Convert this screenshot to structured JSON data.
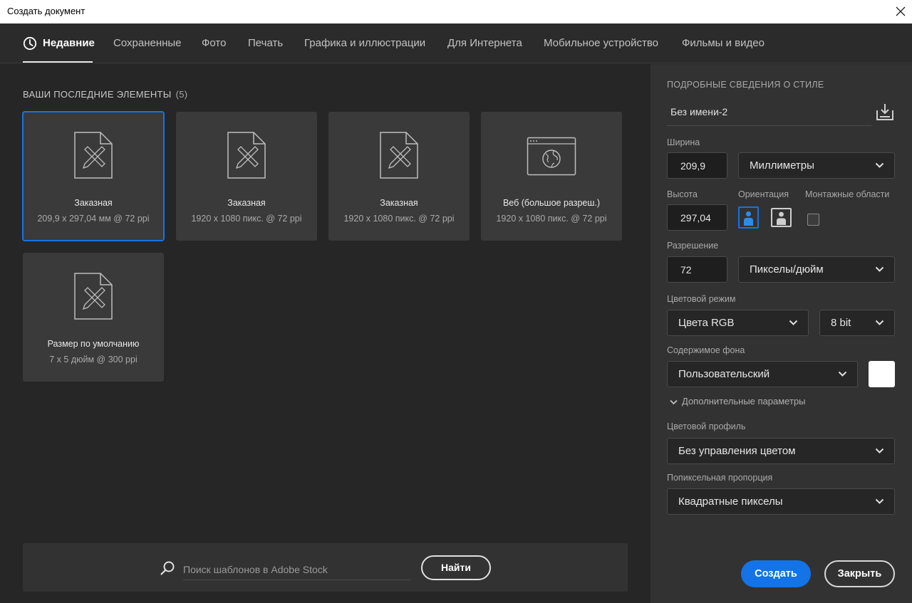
{
  "window": {
    "title": "Создать документ"
  },
  "tabs": [
    {
      "label": "Недавние",
      "active": true
    },
    {
      "label": "Сохраненные"
    },
    {
      "label": "Фото"
    },
    {
      "label": "Печать"
    },
    {
      "label": "Графика и иллюстрации"
    },
    {
      "label": "Для Интернета"
    },
    {
      "label": "Мобильное устройство"
    },
    {
      "label": "Фильмы и видео"
    }
  ],
  "recent": {
    "title": "ВАШИ ПОСЛЕДНИЕ ЭЛЕМЕНТЫ",
    "count": "(5)",
    "items": [
      {
        "name": "Заказная",
        "dims": "209,9 x 297,04 мм @ 72 ppi",
        "icon": "document-pen-ruler-icon",
        "selected": true
      },
      {
        "name": "Заказная",
        "dims": "1920 x 1080 пикс. @ 72 ppi",
        "icon": "document-pen-ruler-icon"
      },
      {
        "name": "Заказная",
        "dims": "1920 x 1080 пикс. @ 72 ppi",
        "icon": "document-pen-ruler-icon"
      },
      {
        "name": "Веб (большое разреш.)",
        "dims": "1920 x 1080 пикс. @ 72 ppi",
        "icon": "web-globe-icon"
      },
      {
        "name": "Размер по умолчанию",
        "dims": "7 x 5 дюйм @ 300 ppi",
        "icon": "document-pen-ruler-icon"
      }
    ]
  },
  "search": {
    "placeholder": "Поиск шаблонов в Adobe Stock",
    "button": "Найти"
  },
  "preset": {
    "heading": "ПОДРОБНЫЕ СВЕДЕНИЯ О СТИЛЕ",
    "name": "Без имени-2",
    "width_label": "Ширина",
    "width_value": "209,9",
    "width_unit": "Миллиметры",
    "height_label": "Высота",
    "height_value": "297,04",
    "orientation_label": "Ориентация",
    "orientation": "portrait",
    "artboards_label": "Монтажные области",
    "artboards_checked": false,
    "resolution_label": "Разрешение",
    "resolution_value": "72",
    "resolution_unit": "Пикселы/дюйм",
    "color_mode_label": "Цветовой режим",
    "color_mode": "Цвета RGB",
    "bit_depth": "8 bit",
    "background_label": "Содержимое фона",
    "background": "Пользовательский",
    "background_color": "#ffffff",
    "advanced_label": "Дополнительные параметры",
    "color_profile_label": "Цветовой профиль",
    "color_profile": "Без управления цветом",
    "pixel_aspect_label": "Попиксельная пропорция",
    "pixel_aspect": "Квадратные пикселы",
    "create_button": "Создать",
    "close_button": "Закрыть"
  },
  "colors": {
    "accent": "#1473e6",
    "panel": "#323232",
    "background": "#262626",
    "card": "#3a3a3a"
  }
}
